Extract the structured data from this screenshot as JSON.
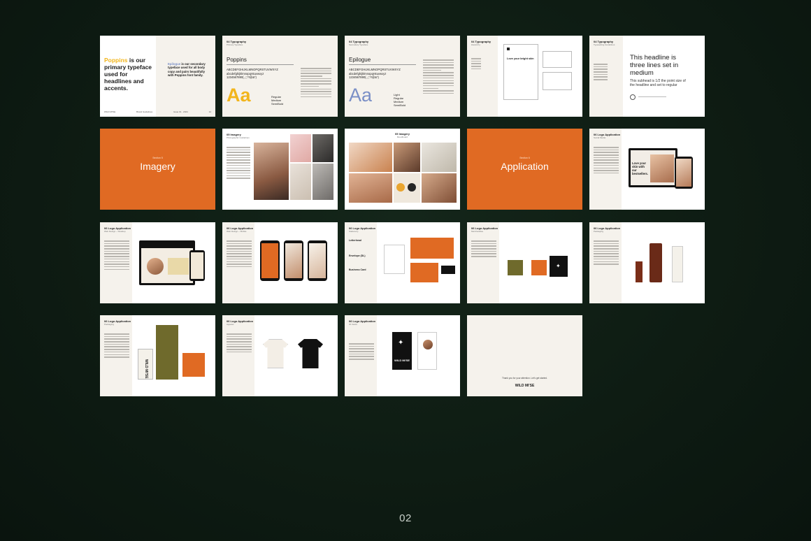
{
  "page_number": "02",
  "slides": {
    "s1": {
      "highlight": "Poppins",
      "headline_rest": " is our primary typeface used for headlines and accents.",
      "secondary_highlight": "Epilogue",
      "secondary_rest": " is our secondary typeface used for all body copy and pairs beautifully with Poppins font family.",
      "foot_left": "WILD MI'SE",
      "foot_mid": "Brand Guidelines",
      "foot_right": "Issue 01 · 2024",
      "foot_page": "14"
    },
    "s2": {
      "header": "04 Typography",
      "header_sub": "Primary Typeface",
      "font_name": "Poppins",
      "upper": "ABCDEFGHIJKLMNOPQRSTUVWXYZ",
      "lower": "abcdefghijklmnopqrstuvwxyz",
      "digits": "1234567890(.,:;?!@&*)",
      "sample": "Aa",
      "weights": [
        "Regular",
        "Medium",
        "SemiBold"
      ]
    },
    "s3": {
      "header": "04 Typography",
      "header_sub": "Secondary Typeface",
      "font_name": "Epilogue",
      "upper": "ABCDEFGHIJKLMNOPQRSTUVWXYZ",
      "lower": "abcdefghijklmnopqrstuvwxyz",
      "digits": "1234567890(.,:;?!@&*)",
      "sample": "Aa",
      "weights": [
        "Light",
        "Regular",
        "Medium",
        "SemiBold"
      ]
    },
    "s4": {
      "header": "04 Typography",
      "header_sub": "Hierarchy"
    },
    "s5": {
      "header": "04 Typography",
      "header_sub": "Typesetting Guidelines",
      "headline": "This headline is three lines set in medium",
      "subhead": "This subhead is 1/2 the point size of the headline and set to regular"
    },
    "s6": {
      "kicker": "Section 5",
      "title": "Imagery"
    },
    "s7": {
      "header": "05 Imagery",
      "header_sub": "Photographic Guidelines"
    },
    "s8": {
      "header": "05 Imagery",
      "header_sub": "Moodboard"
    },
    "s9": {
      "kicker": "Section 6",
      "title": "Application"
    },
    "s10": {
      "header": "06 Logo Application",
      "header_sub": "Social Media",
      "ad_text": "Love your skin with our bestsellers."
    },
    "s11": {
      "header": "06 Logo Application",
      "header_sub": "Web Design – Desktop"
    },
    "s12": {
      "header": "06 Logo Application",
      "header_sub": "Web Design – Mobile"
    },
    "s13": {
      "header": "06 Logo Application",
      "header_sub": "Stationery",
      "items": [
        "Letterhead",
        "Envelope (DL)",
        "Business Card"
      ]
    },
    "s14": {
      "header": "06 Logo Application",
      "header_sub": "Merchandise"
    },
    "s15": {
      "header": "06 Logo Application",
      "header_sub": "Packaging"
    },
    "s16": {
      "header": "06 Logo Application",
      "header_sub": "Packaging",
      "box_text": "WILD MI'SE"
    },
    "s17": {
      "header": "06 Logo Application",
      "header_sub": "Apparel"
    },
    "s18": {
      "header": "06 Logo Application",
      "header_sub": "ID Cards",
      "card_text": "WILD MI'SE"
    },
    "s19": {
      "thanks": "Thank you for your attention. Let's get started.",
      "logo": "WILD MI'SE"
    }
  },
  "colors": {
    "accent_orange": "#e06a23",
    "poppins_yellow": "#f2b51c",
    "epilogue_blue": "#7a8fc6",
    "olive": "#6f6a2c",
    "background": "#0e1c13"
  }
}
